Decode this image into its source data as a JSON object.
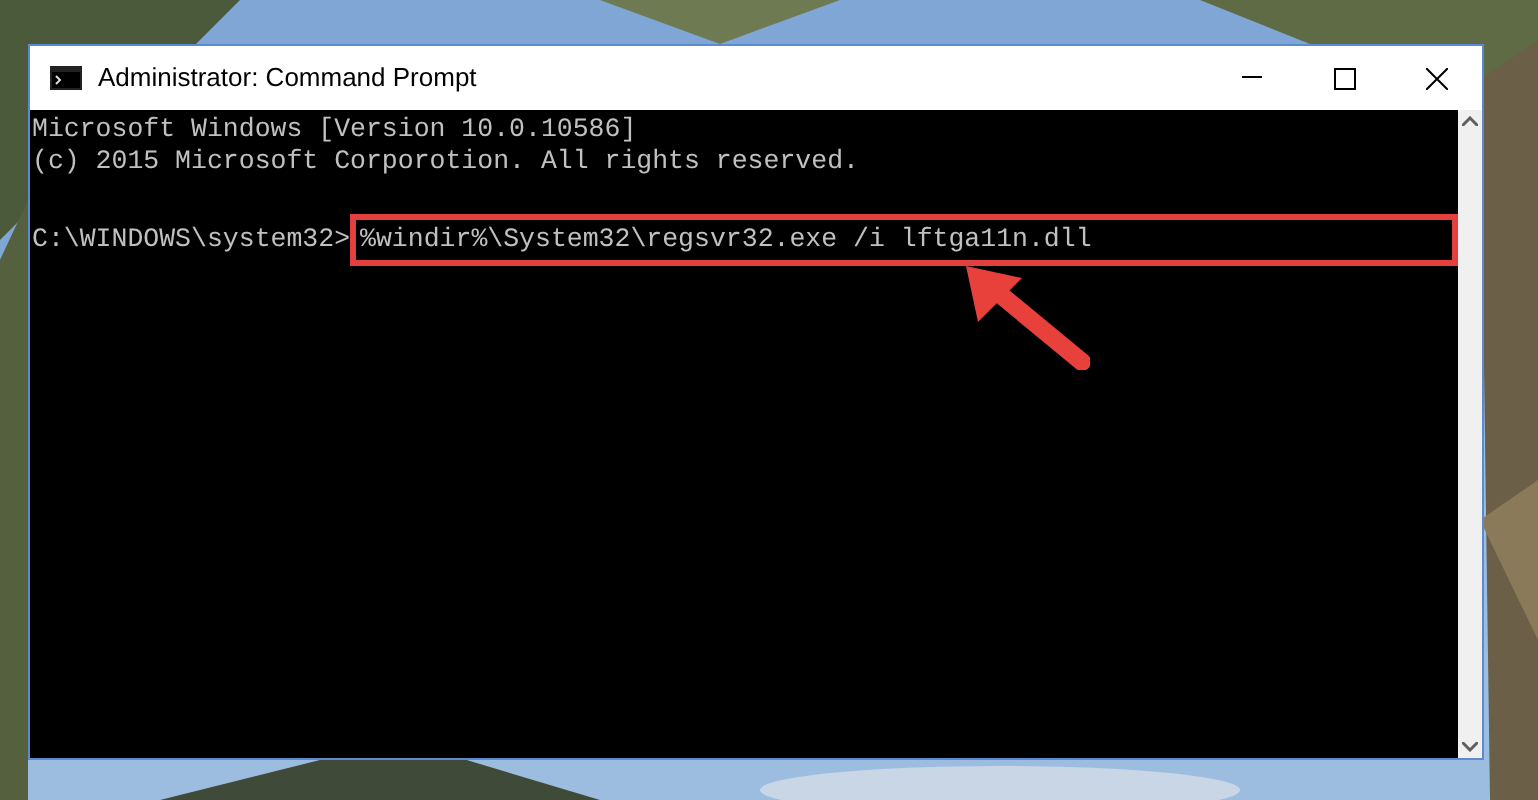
{
  "window": {
    "title": "Administrator: Command Prompt"
  },
  "console": {
    "lines": [
      "Microsoft Windows [Version 10.0.10586]",
      "(c) 2015 Microsoft Corporotion. All rights reserved."
    ],
    "prompt": "C:\\WINDOWS\\system32>",
    "command": "%windir%\\System32\\regsvr32.exe /i lftga11n.dll",
    "highlighted": true
  }
}
